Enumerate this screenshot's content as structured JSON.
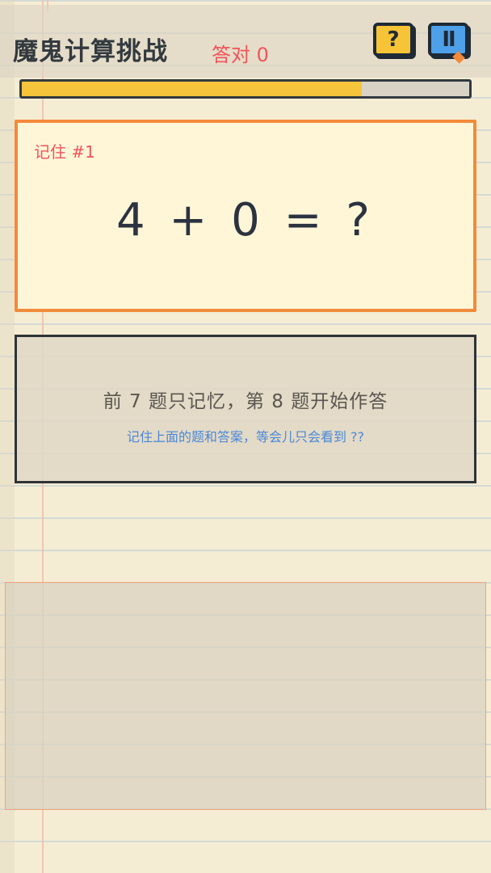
{
  "header": {
    "title": "魔鬼计算挑战",
    "score_label": "答对 0",
    "help_icon_glyph": "?",
    "pause_icon_glyph": "II"
  },
  "progress": {
    "fraction": 0.76,
    "fill_color": "#f5c43b"
  },
  "question": {
    "label": "记住 #1",
    "equation": "4 + 0 = ?"
  },
  "info": {
    "main_text": "前 7 题只记忆，第 8 题开始作答",
    "sub_text": "记住上面的题和答案，等会儿只会看到 ??"
  },
  "colors": {
    "accent_orange": "#f28a3b",
    "score_red": "#f2545b",
    "help_yellow": "#f7c437",
    "pause_blue": "#4ea0e8",
    "hint_blue": "#4a88d8"
  }
}
